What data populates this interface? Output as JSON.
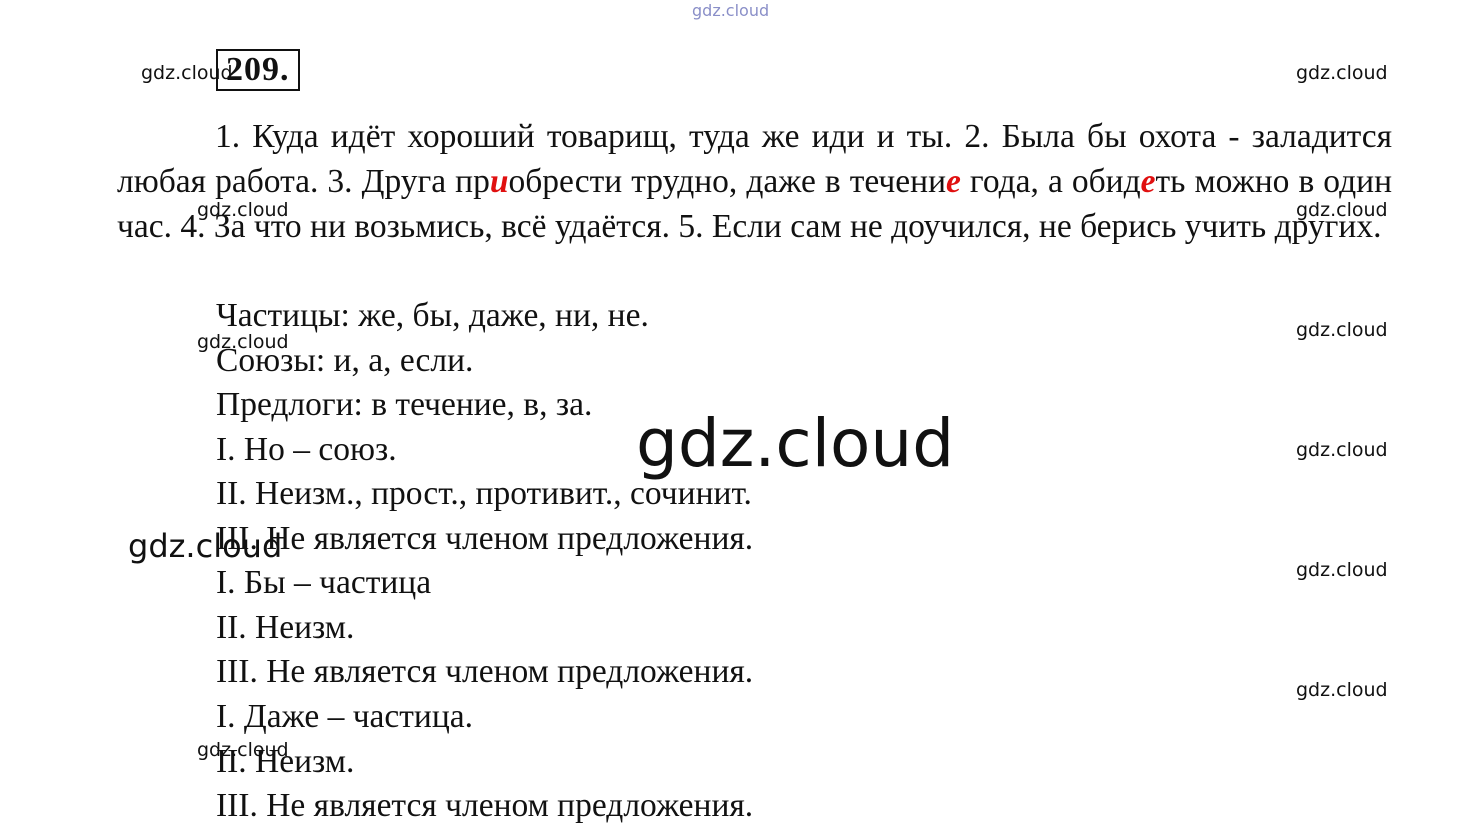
{
  "watermark": {
    "text": "gdz.cloud"
  },
  "task": {
    "number": "209."
  },
  "paragraph": {
    "segments": [
      {
        "t": "1. Куда идёт хороший товарищ, туда же иди и ты. 2. Была бы охота - заладится любая работа. 3. Друга пр",
        "hl": false
      },
      {
        "t": "и",
        "hl": true
      },
      {
        "t": "обрести трудно, даже в течени",
        "hl": false
      },
      {
        "t": "е",
        "hl": true
      },
      {
        "t": " года, а обид",
        "hl": false
      },
      {
        "t": "е",
        "hl": true
      },
      {
        "t": "ть можно в один час. 4. За что ни возьмись, всё удаётся. 5. Если сам не доучился, не берись учить других.",
        "hl": false
      }
    ]
  },
  "lines": [
    "Частицы: же, бы, даже, ни, не.",
    "Союзы: и, а, если.",
    "Предлоги: в течение, в, за.",
    "I. Но – союз.",
    "II. Неизм., прост., противит., сочинит.",
    "III. Не является членом предложения.",
    "I. Бы – частица",
    "II. Неизм.",
    "III. Не является членом предложения.",
    "I. Даже – частица.",
    "II. Неизм.",
    "III. Не является членом предложения."
  ],
  "colors": {
    "highlight": "#e01010",
    "text": "#111111",
    "watermark_top": "#8a8fc8"
  }
}
